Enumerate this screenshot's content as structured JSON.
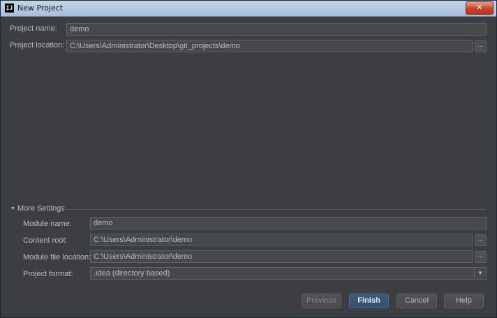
{
  "window": {
    "title": "New Project",
    "app_icon_text": "IJ",
    "close_glyph": "✕"
  },
  "project": {
    "name_label": "Project name:",
    "name_value": "demo",
    "location_label": "Project location:",
    "location_value": "C:\\Users\\Administrator\\Desktop\\git_projects\\demo"
  },
  "more_settings": {
    "label": "More Settings",
    "toggle_glyph": "▼",
    "module_name_label": "Module name:",
    "module_name_value": "demo",
    "content_root_label": "Content root:",
    "content_root_value": "C:\\Users\\Administrator\\demo",
    "module_file_label": "Module file location:",
    "module_file_value": "C:\\Users\\Administrator\\demo",
    "format_label": "Project format:",
    "format_value": ".idea (directory based)"
  },
  "browse_label": "...",
  "buttons": {
    "previous": "Previous",
    "finish": "Finish",
    "cancel": "Cancel",
    "help": "Help"
  },
  "colors": {
    "background": "#3c3f41",
    "field_bg": "#45494a",
    "text": "#bbbbbb",
    "primary_button": "#35506c",
    "title_bar": "#b4c8de"
  }
}
